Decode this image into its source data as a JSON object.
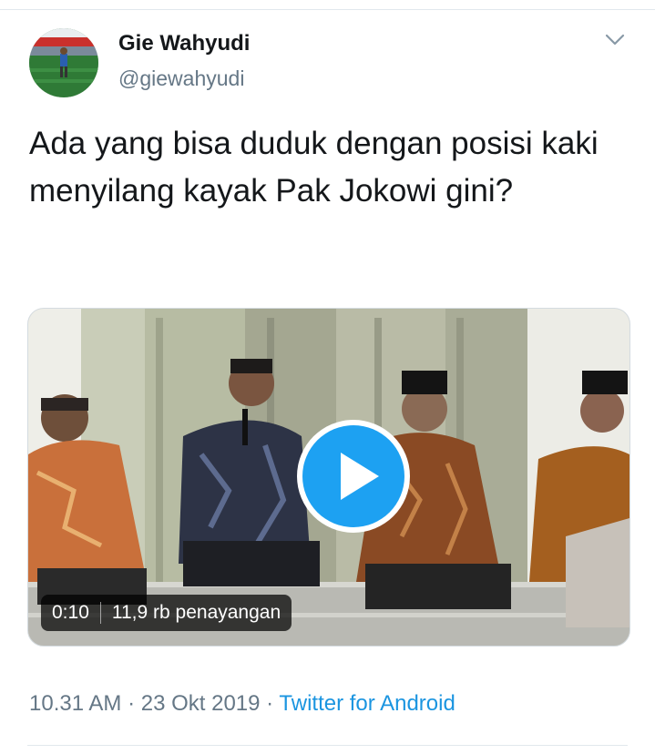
{
  "tweet": {
    "author_name": "Gie Wahyudi",
    "author_handle": "@giewahyudi",
    "text": "Ada yang bisa duduk dengan posisi kaki menyilang kayak Pak Jokowi gini?",
    "time": "10.31 AM",
    "dot1": " · ",
    "date": "23 Okt 2019",
    "dot2": " · ",
    "source": "Twitter for Android"
  },
  "video": {
    "duration": "0:10",
    "views": "11,9 rb penayangan"
  },
  "icons": {
    "menu": "chevron-down-icon",
    "play": "play-icon"
  },
  "colors": {
    "accent": "#1b95e0",
    "text_primary": "#14171a",
    "text_secondary": "#657786",
    "play_blue": "#1da1f2"
  }
}
